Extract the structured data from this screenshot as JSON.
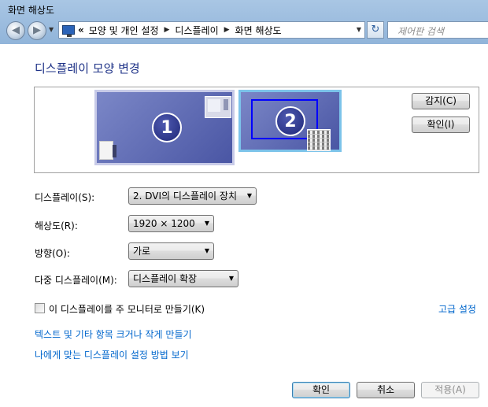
{
  "window": {
    "title": "화면 해상도"
  },
  "address_bar": {
    "chevron": "«",
    "crumbs": [
      "모양 및 개인 설정",
      "디스플레이",
      "화면 해상도"
    ],
    "search_placeholder": "제어판 검색"
  },
  "heading": "디스플레이 모양 변경",
  "monitors": {
    "monitor1_number": "1",
    "monitor2_number": "2",
    "detect_label": "감지(C)",
    "identify_label": "확인(I)"
  },
  "settings": {
    "display_label": "디스플레이(S):",
    "display_value": "2. DVI의 디스플레이 장치",
    "resolution_label": "해상도(R):",
    "resolution_value": "1920 × 1200",
    "orientation_label": "방향(O):",
    "orientation_value": "가로",
    "multi_label": "다중 디스플레이(M):",
    "multi_value": "디스플레이 확장"
  },
  "primary_checkbox": {
    "label": "이 디스플레이를 주 모니터로 만들기(K)",
    "checked": false
  },
  "links": {
    "advanced": "고급 설정",
    "text_size": "텍스트 및 기타 항목 크거나 작게 만들기",
    "help": "나에게 맞는 디스플레이 설정 방법 보기"
  },
  "buttons": {
    "ok": "확인",
    "cancel": "취소",
    "apply": "적용(A)"
  },
  "colors": {
    "link": "#0066cc",
    "heading": "#1e3287",
    "selection": "#0000ff"
  }
}
